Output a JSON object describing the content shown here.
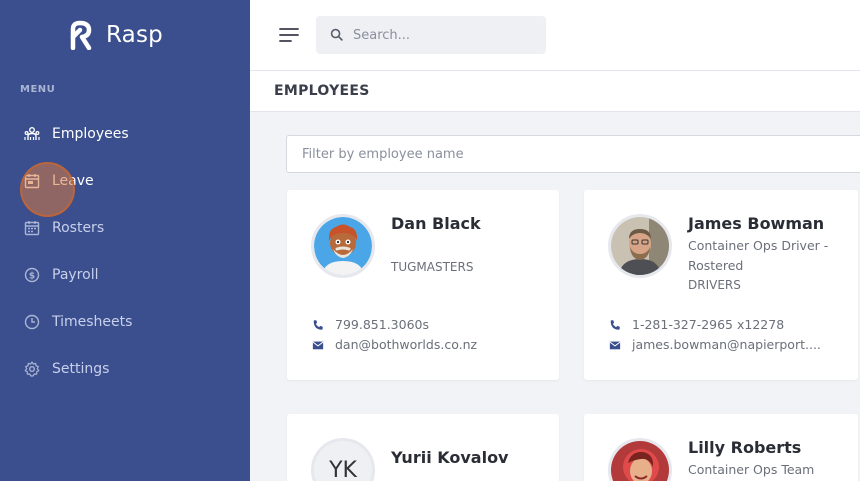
{
  "app": {
    "name": "Rasp"
  },
  "sidebar": {
    "menu_label": "MENU",
    "items": [
      {
        "label": "Employees",
        "icon": "employees-icon",
        "active": true
      },
      {
        "label": "Leave",
        "icon": "calendar-icon",
        "active": false
      },
      {
        "label": "Rosters",
        "icon": "roster-calendar-icon",
        "active": false
      },
      {
        "label": "Payroll",
        "icon": "dollar-circle-icon",
        "active": false
      },
      {
        "label": "Timesheets",
        "icon": "clock-icon",
        "active": false
      },
      {
        "label": "Settings",
        "icon": "gear-icon",
        "active": false
      }
    ]
  },
  "search": {
    "placeholder": "Search..."
  },
  "page": {
    "title": "EMPLOYEES"
  },
  "filter": {
    "placeholder": "Filter by employee name"
  },
  "employees": [
    {
      "name": "Dan Black",
      "role": "",
      "company": "TUGMASTERS",
      "phone": "799.851.3060s",
      "email": "dan@bothworlds.co.nz",
      "avatar": "cartoon-avatar"
    },
    {
      "name": "James Bowman",
      "role": "Container Ops Driver - Rostered",
      "company": "DRIVERS",
      "phone": "1-281-327-2965 x12278",
      "email": "james.bowman@napierport....",
      "avatar": "photo-avatar"
    },
    {
      "name": "Yurii Kovalov",
      "initials": "YK",
      "avatar": "initials-avatar"
    },
    {
      "name": "Lilly Roberts",
      "role": "Container Ops Team",
      "avatar": "photo-avatar"
    }
  ],
  "colors": {
    "sidebar": "#3b4f8e",
    "background": "#f2f3f7",
    "accent": "#3b4f8e"
  }
}
